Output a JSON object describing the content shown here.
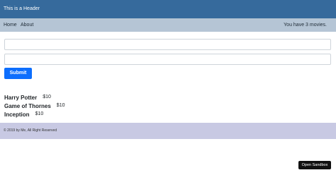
{
  "header": {
    "title": "This is a Header"
  },
  "nav": {
    "home_label": "Home",
    "about_label": "About",
    "movie_count": "You have 3 movies."
  },
  "form": {
    "field1_value": "",
    "field2_value": "",
    "submit_label": "Submit"
  },
  "movies": [
    {
      "title": "Harry Potter",
      "price": "$10"
    },
    {
      "title": "Game of Thornes",
      "price": "$10"
    },
    {
      "title": "Inception",
      "price": "$10"
    }
  ],
  "footer": {
    "text": "© 2019 by Me, All Right Reserved"
  },
  "sandbox": {
    "label": "Open Sandbox"
  },
  "colors": {
    "header_bg": "#366a9c",
    "nav_bg": "#b5c5d5",
    "submit_bg": "#0d6efd",
    "footer_bg": "#c8c9e3",
    "sandbox_bg": "#111111"
  }
}
